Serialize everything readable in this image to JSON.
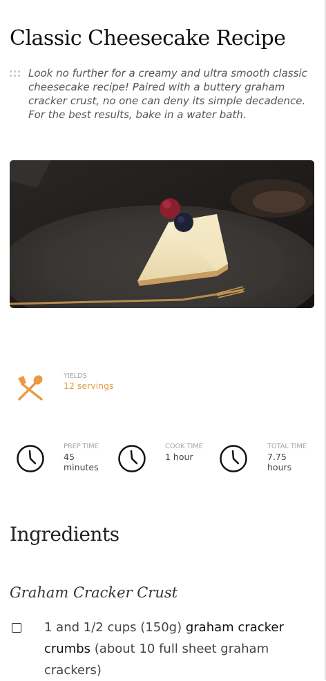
{
  "recipe": {
    "title": "Classic Cheesecake Recipe",
    "intro": "Look no further for a creamy and ultra smooth classic cheesecake recipe! Paired with a buttery graham cracker crust, no one can deny its simple decadence. For the best results, bake in a water bath."
  },
  "meta": {
    "yields_label": "YIELDS",
    "yields_value": "12 servings",
    "prep_label": "PREP TIME",
    "prep_value": "45 minutes",
    "cook_label": "COOK TIME",
    "cook_value": "1 hour",
    "total_label": "TOTAL TIME",
    "total_value": "7.75 hours"
  },
  "ingredients": {
    "heading": "Ingredients",
    "group_title": "Graham Cracker Crust",
    "items": [
      {
        "amount": "1 and 1/2 cups (150g)",
        "name": "graham cracker crumbs",
        "note": "(about 10 full sheet graham crackers)"
      }
    ]
  },
  "colors": {
    "accent": "#e89a44",
    "text": "#222222",
    "muted": "#a6a6a6"
  },
  "icons": {
    "yields": "fork-spoon-icon",
    "time": "clock-icon",
    "drag": "drag-handle-icon",
    "checkbox": "checkbox-icon"
  }
}
